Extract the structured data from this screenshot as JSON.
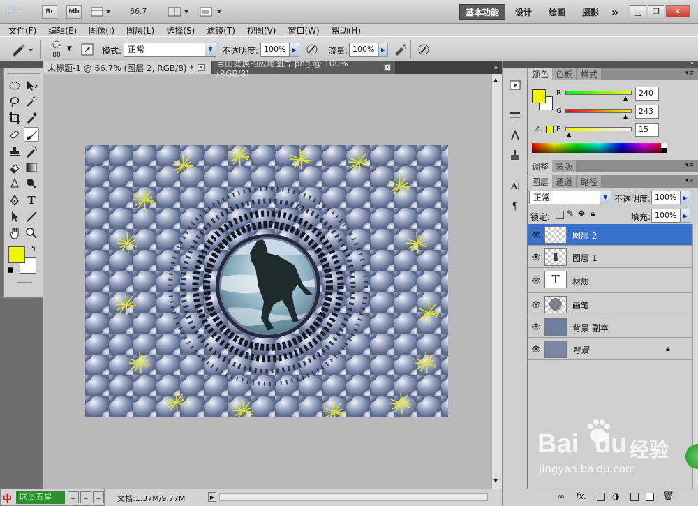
{
  "app": {
    "logo": "Ps",
    "btn_br": "Br",
    "btn_mb": "Mb",
    "zoom": "66.7",
    "workspaces": [
      "基本功能",
      "设计",
      "绘画",
      "摄影"
    ],
    "more": "»"
  },
  "menu": [
    "文件(F)",
    "编辑(E)",
    "图像(I)",
    "图层(L)",
    "选择(S)",
    "滤镜(T)",
    "视图(V)",
    "窗口(W)",
    "帮助(H)"
  ],
  "options": {
    "brush_size": "80",
    "mode_label": "模式:",
    "mode_value": "正常",
    "opacity_label": "不透明度:",
    "opacity_value": "100%",
    "flow_label": "流量:",
    "flow_value": "100%"
  },
  "tabs": [
    {
      "label": "未标题-1 @ 66.7% (图层 2, RGB/8) *",
      "active": true
    },
    {
      "label": "自由变换的应用图片.png @ 100%(RGB/8)",
      "active": false
    }
  ],
  "status": {
    "doc": "文档:1.37M/9.77M"
  },
  "taskbar": {
    "label": "球员五星"
  },
  "color_panel": {
    "tabs": [
      "颜色",
      "色板",
      "样式"
    ],
    "r_label": "R",
    "r_value": "240",
    "g_label": "G",
    "g_value": "243",
    "b_label": "B",
    "b_value": "15",
    "foreground": "#f0f30f"
  },
  "adjust_panel": {
    "tabs": [
      "调整",
      "蒙版"
    ]
  },
  "layers_panel": {
    "tabs": [
      "图层",
      "通道",
      "路径"
    ],
    "blend_mode": "正常",
    "opacity_label": "不透明度:",
    "opacity_value": "100%",
    "lock_label": "锁定:",
    "fill_label": "填充:",
    "fill_value": "100%",
    "layers": [
      {
        "name": "图层 2",
        "selected": true
      },
      {
        "name": "图层 1",
        "selected": false
      },
      {
        "name": "材质",
        "selected": false
      },
      {
        "name": "画笔",
        "selected": false
      },
      {
        "name": "背景 副本",
        "selected": false
      },
      {
        "name": "背景",
        "selected": false
      }
    ]
  },
  "watermark": {
    "brand": "Bai",
    "brand2": "du",
    "cn": "经验",
    "url": "jingyan.baidu.com"
  }
}
